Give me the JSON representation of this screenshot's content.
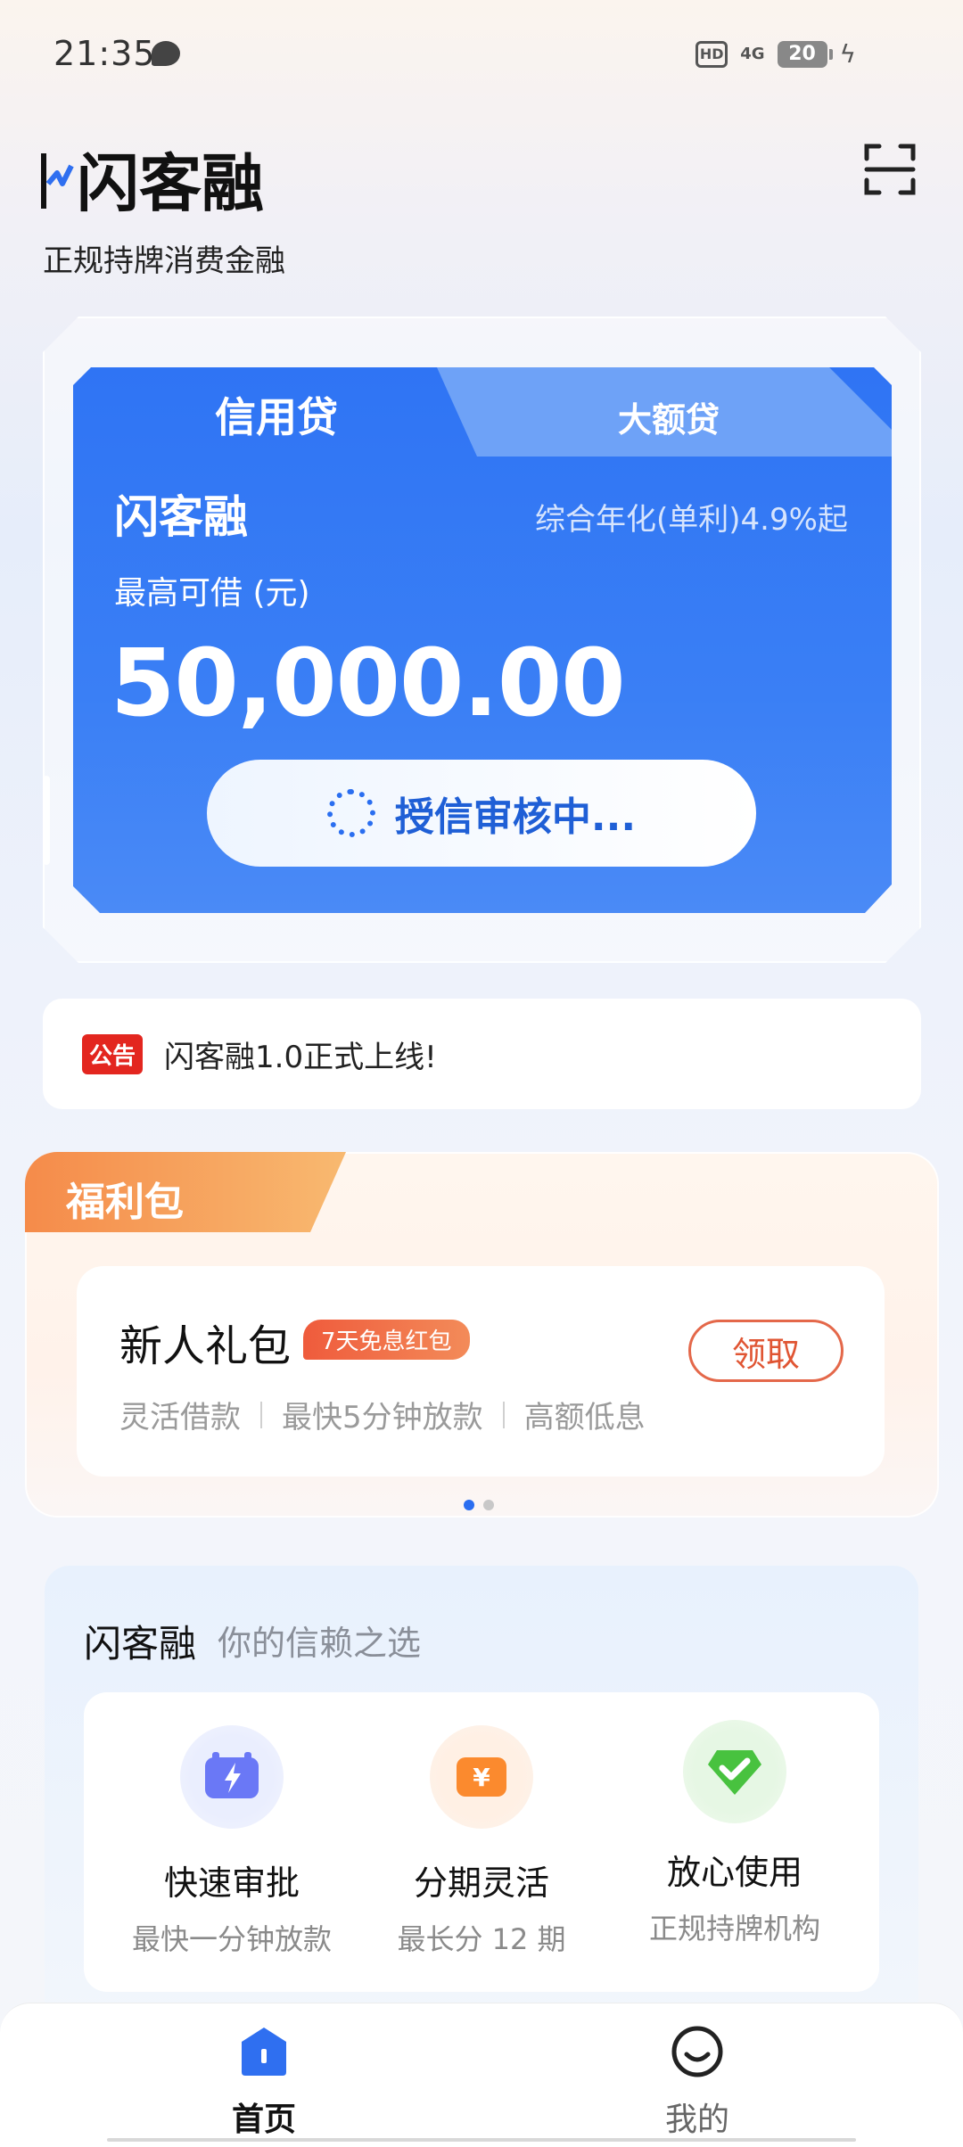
{
  "status_bar": {
    "time": "21:35",
    "hd": "HD",
    "network": "4G",
    "battery": "20"
  },
  "header": {
    "logo_text": "闪客融",
    "slogan": "正规持牌消费金融"
  },
  "loan_card": {
    "tabs": [
      {
        "label": "信用贷",
        "active": true
      },
      {
        "label": "大额贷",
        "active": false
      }
    ],
    "product_name": "闪客融",
    "rate_text": "综合年化(单利)4.9%起",
    "max_label": "最高可借 (元)",
    "amount": "50,000.00",
    "review_button": "授信审核中..."
  },
  "notice": {
    "tag": "公告",
    "text": "闪客融1.0正式上线!"
  },
  "welfare": {
    "title": "福利包",
    "gift_title": "新人礼包",
    "gift_badge": "7天免息红包",
    "features": [
      "灵活借款",
      "最快5分钟放款",
      "高额低息"
    ],
    "claim_button": "领取",
    "pager": {
      "count": 2,
      "active": 0
    }
  },
  "trust": {
    "title": "闪客融",
    "subtitle": "你的信赖之选",
    "features": [
      {
        "icon": "tv-lightning-icon",
        "name": "快速审批",
        "desc": "最快一分钟放款"
      },
      {
        "icon": "yen-card-icon",
        "name": "分期灵活",
        "desc": "最长分 12 期"
      },
      {
        "icon": "shield-check-icon",
        "name": "放心使用",
        "desc": "正规持牌机构"
      }
    ]
  },
  "bottom_nav": {
    "items": [
      {
        "label": "首页",
        "icon": "home-icon",
        "active": true
      },
      {
        "label": "我的",
        "icon": "smiley-icon",
        "active": false
      }
    ]
  },
  "colors": {
    "primary": "#2f74f4",
    "accent_orange": "#f58b4a",
    "claim_orange": "#e05533",
    "notice_red": "#e3261f"
  }
}
